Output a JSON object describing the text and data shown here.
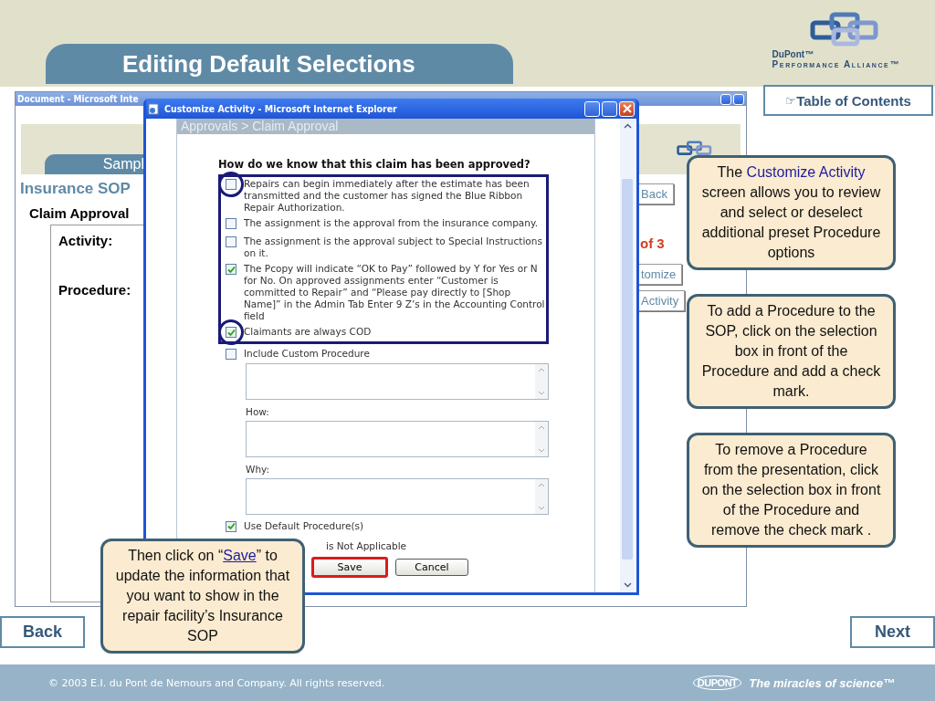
{
  "header": {
    "title": "Editing Default Selections",
    "logo": {
      "brand": "DuPont™",
      "tagline": "Performance Alliance™"
    }
  },
  "toc_link": {
    "icon": "☞",
    "label": "Table of Contents"
  },
  "background_window": {
    "title": "Document - Microsoft Inte",
    "tab": "Sampl",
    "heading": "Insurance SOP",
    "subheading": "Claim Approval",
    "fields": [
      "Activity:",
      "Procedure:"
    ],
    "right_fragments": [
      {
        "kind": "button",
        "text": "Back"
      },
      {
        "kind": "counter",
        "text": "of 3"
      },
      {
        "kind": "button",
        "text": "tomize"
      },
      {
        "kind": "button",
        "text": "Activity"
      }
    ]
  },
  "dialog": {
    "title": "Customize Activity - Microsoft Internet Explorer",
    "breadcrumb": "Approvals > Claim Approval",
    "question": "How do we know that this claim has been approved?",
    "options": [
      {
        "label": "Repairs can begin immediately after the estimate has been transmitted and the customer has signed the Blue Ribbon Repair Authorization.",
        "checked": false,
        "circled": true
      },
      {
        "label": "The assignment is the approval from the insurance company.",
        "checked": false,
        "circled": false
      },
      {
        "label": "The assignment is the approval subject to Special Instructions on it.",
        "checked": false,
        "circled": false
      },
      {
        "label": "The Pcopy will indicate “OK to Pay” followed by Y for Yes or N for No. On approved assignments enter “Customer is committed to Repair” and “Please pay directly to [Shop Name]” in the Admin Tab Enter 9 Z’s in the Accounting Control field",
        "checked": true,
        "circled": false
      },
      {
        "label": "Claimants are always COD",
        "checked": true,
        "circled": true
      }
    ],
    "custom": {
      "label": "Include Custom Procedure",
      "checked": false
    },
    "text_areas": [
      {
        "label": "How:"
      },
      {
        "label": "Why:"
      }
    ],
    "default_option": {
      "label": "Use Default Procedure(s)",
      "checked": true
    },
    "not_applicable_fragment": "is Not Applicable",
    "buttons": [
      {
        "label": "Save",
        "highlighted": true
      },
      {
        "label": "Cancel",
        "highlighted": false
      }
    ]
  },
  "callouts": [
    {
      "segments": [
        {
          "kind": "plain",
          "text": "The "
        },
        {
          "kind": "term",
          "text": "Customize Activity"
        },
        {
          "kind": "plain",
          "text": " screen allows you to review and select or deselect additional preset Procedure options"
        }
      ]
    },
    {
      "segments": [
        {
          "kind": "plain",
          "text": "To add a Procedure to the SOP, click on the selection box in front of the Procedure and add a check mark."
        }
      ]
    },
    {
      "segments": [
        {
          "kind": "plain",
          "text": "To remove a Procedure from the presentation, click on the selection box in front of the Procedure and remove the check mark ."
        }
      ]
    },
    {
      "segments": [
        {
          "kind": "plain",
          "text": "Then click on “"
        },
        {
          "kind": "link",
          "text": "Save"
        },
        {
          "kind": "plain",
          "text": "” to update the information that you want to show in the repair facility’s Insurance SOP"
        }
      ]
    }
  ],
  "nav": {
    "back": "Back",
    "next": "Next"
  },
  "footer": {
    "copyright": "© 2003 E.I. du Pont de Nemours and Company. All rights reserved.",
    "brand": "DUPONT",
    "slogan": "The miracles of science™"
  }
}
